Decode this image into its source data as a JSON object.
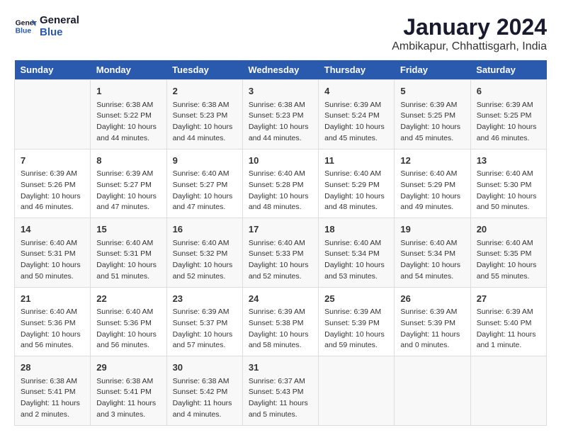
{
  "logo": {
    "line1": "General",
    "line2": "Blue"
  },
  "title": "January 2024",
  "subtitle": "Ambikapur, Chhattisgarh, India",
  "days_header": [
    "Sunday",
    "Monday",
    "Tuesday",
    "Wednesday",
    "Thursday",
    "Friday",
    "Saturday"
  ],
  "weeks": [
    [
      {
        "day": "",
        "content": ""
      },
      {
        "day": "1",
        "content": "Sunrise: 6:38 AM\nSunset: 5:22 PM\nDaylight: 10 hours\nand 44 minutes."
      },
      {
        "day": "2",
        "content": "Sunrise: 6:38 AM\nSunset: 5:23 PM\nDaylight: 10 hours\nand 44 minutes."
      },
      {
        "day": "3",
        "content": "Sunrise: 6:38 AM\nSunset: 5:23 PM\nDaylight: 10 hours\nand 44 minutes."
      },
      {
        "day": "4",
        "content": "Sunrise: 6:39 AM\nSunset: 5:24 PM\nDaylight: 10 hours\nand 45 minutes."
      },
      {
        "day": "5",
        "content": "Sunrise: 6:39 AM\nSunset: 5:25 PM\nDaylight: 10 hours\nand 45 minutes."
      },
      {
        "day": "6",
        "content": "Sunrise: 6:39 AM\nSunset: 5:25 PM\nDaylight: 10 hours\nand 46 minutes."
      }
    ],
    [
      {
        "day": "7",
        "content": "Sunrise: 6:39 AM\nSunset: 5:26 PM\nDaylight: 10 hours\nand 46 minutes."
      },
      {
        "day": "8",
        "content": "Sunrise: 6:39 AM\nSunset: 5:27 PM\nDaylight: 10 hours\nand 47 minutes."
      },
      {
        "day": "9",
        "content": "Sunrise: 6:40 AM\nSunset: 5:27 PM\nDaylight: 10 hours\nand 47 minutes."
      },
      {
        "day": "10",
        "content": "Sunrise: 6:40 AM\nSunset: 5:28 PM\nDaylight: 10 hours\nand 48 minutes."
      },
      {
        "day": "11",
        "content": "Sunrise: 6:40 AM\nSunset: 5:29 PM\nDaylight: 10 hours\nand 48 minutes."
      },
      {
        "day": "12",
        "content": "Sunrise: 6:40 AM\nSunset: 5:29 PM\nDaylight: 10 hours\nand 49 minutes."
      },
      {
        "day": "13",
        "content": "Sunrise: 6:40 AM\nSunset: 5:30 PM\nDaylight: 10 hours\nand 50 minutes."
      }
    ],
    [
      {
        "day": "14",
        "content": "Sunrise: 6:40 AM\nSunset: 5:31 PM\nDaylight: 10 hours\nand 50 minutes."
      },
      {
        "day": "15",
        "content": "Sunrise: 6:40 AM\nSunset: 5:31 PM\nDaylight: 10 hours\nand 51 minutes."
      },
      {
        "day": "16",
        "content": "Sunrise: 6:40 AM\nSunset: 5:32 PM\nDaylight: 10 hours\nand 52 minutes."
      },
      {
        "day": "17",
        "content": "Sunrise: 6:40 AM\nSunset: 5:33 PM\nDaylight: 10 hours\nand 52 minutes."
      },
      {
        "day": "18",
        "content": "Sunrise: 6:40 AM\nSunset: 5:34 PM\nDaylight: 10 hours\nand 53 minutes."
      },
      {
        "day": "19",
        "content": "Sunrise: 6:40 AM\nSunset: 5:34 PM\nDaylight: 10 hours\nand 54 minutes."
      },
      {
        "day": "20",
        "content": "Sunrise: 6:40 AM\nSunset: 5:35 PM\nDaylight: 10 hours\nand 55 minutes."
      }
    ],
    [
      {
        "day": "21",
        "content": "Sunrise: 6:40 AM\nSunset: 5:36 PM\nDaylight: 10 hours\nand 56 minutes."
      },
      {
        "day": "22",
        "content": "Sunrise: 6:40 AM\nSunset: 5:36 PM\nDaylight: 10 hours\nand 56 minutes."
      },
      {
        "day": "23",
        "content": "Sunrise: 6:39 AM\nSunset: 5:37 PM\nDaylight: 10 hours\nand 57 minutes."
      },
      {
        "day": "24",
        "content": "Sunrise: 6:39 AM\nSunset: 5:38 PM\nDaylight: 10 hours\nand 58 minutes."
      },
      {
        "day": "25",
        "content": "Sunrise: 6:39 AM\nSunset: 5:39 PM\nDaylight: 10 hours\nand 59 minutes."
      },
      {
        "day": "26",
        "content": "Sunrise: 6:39 AM\nSunset: 5:39 PM\nDaylight: 11 hours\nand 0 minutes."
      },
      {
        "day": "27",
        "content": "Sunrise: 6:39 AM\nSunset: 5:40 PM\nDaylight: 11 hours\nand 1 minute."
      }
    ],
    [
      {
        "day": "28",
        "content": "Sunrise: 6:38 AM\nSunset: 5:41 PM\nDaylight: 11 hours\nand 2 minutes."
      },
      {
        "day": "29",
        "content": "Sunrise: 6:38 AM\nSunset: 5:41 PM\nDaylight: 11 hours\nand 3 minutes."
      },
      {
        "day": "30",
        "content": "Sunrise: 6:38 AM\nSunset: 5:42 PM\nDaylight: 11 hours\nand 4 minutes."
      },
      {
        "day": "31",
        "content": "Sunrise: 6:37 AM\nSunset: 5:43 PM\nDaylight: 11 hours\nand 5 minutes."
      },
      {
        "day": "",
        "content": ""
      },
      {
        "day": "",
        "content": ""
      },
      {
        "day": "",
        "content": ""
      }
    ]
  ]
}
